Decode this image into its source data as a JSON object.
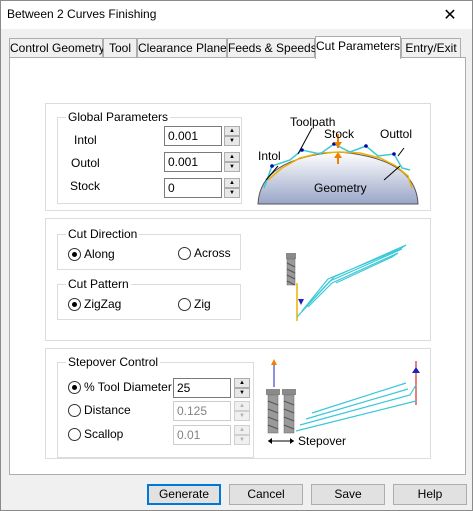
{
  "window": {
    "title": "Between 2 Curves Finishing",
    "close_glyph": "✕"
  },
  "tabs": [
    {
      "label": "Control Geometry",
      "active": false
    },
    {
      "label": "Tool",
      "active": false
    },
    {
      "label": "Clearance Plane",
      "active": false
    },
    {
      "label": "Feeds & Speeds",
      "active": false
    },
    {
      "label": "Cut Parameters",
      "active": true
    },
    {
      "label": "Entry/Exit",
      "active": false
    }
  ],
  "global_parameters": {
    "title": "Global Parameters",
    "intol_label": "Intol",
    "intol_value": "0.001",
    "outol_label": "Outol",
    "outol_value": "0.001",
    "stock_label": "Stock",
    "stock_value": "0"
  },
  "global_diagram": {
    "toolpath": "Toolpath",
    "stock": "Stock",
    "outtol": "Outtol",
    "intol": "Intol",
    "geometry": "Geometry"
  },
  "cut_direction": {
    "title": "Cut Direction",
    "along_label": "Along",
    "along_checked": true,
    "across_label": "Across",
    "across_checked": false
  },
  "cut_pattern": {
    "title": "Cut Pattern",
    "zigzag_label": "ZigZag",
    "zigzag_checked": true,
    "zig_label": "Zig",
    "zig_checked": false
  },
  "stepover_control": {
    "title": "Stepover Control",
    "tool_diameter_label": "% Tool Diameter",
    "tool_diameter_value": "25",
    "tool_diameter_checked": true,
    "distance_label": "Distance",
    "distance_value": "0.125",
    "distance_checked": false,
    "scallop_label": "Scallop",
    "scallop_value": "0.01",
    "scallop_checked": false
  },
  "stepover_diagram": {
    "stepover": "Stepover"
  },
  "buttons": {
    "generate": "Generate",
    "cancel": "Cancel",
    "save": "Save",
    "help": "Help"
  },
  "spin_glyphs": {
    "up": "▲",
    "down": "▼"
  },
  "colors": {
    "accent": "#0078d7",
    "toolpath": "#3cc8d8",
    "arrow_orange": "#f08000",
    "arrow_blue": "#2020c0",
    "arrow_red": "#d00000"
  }
}
